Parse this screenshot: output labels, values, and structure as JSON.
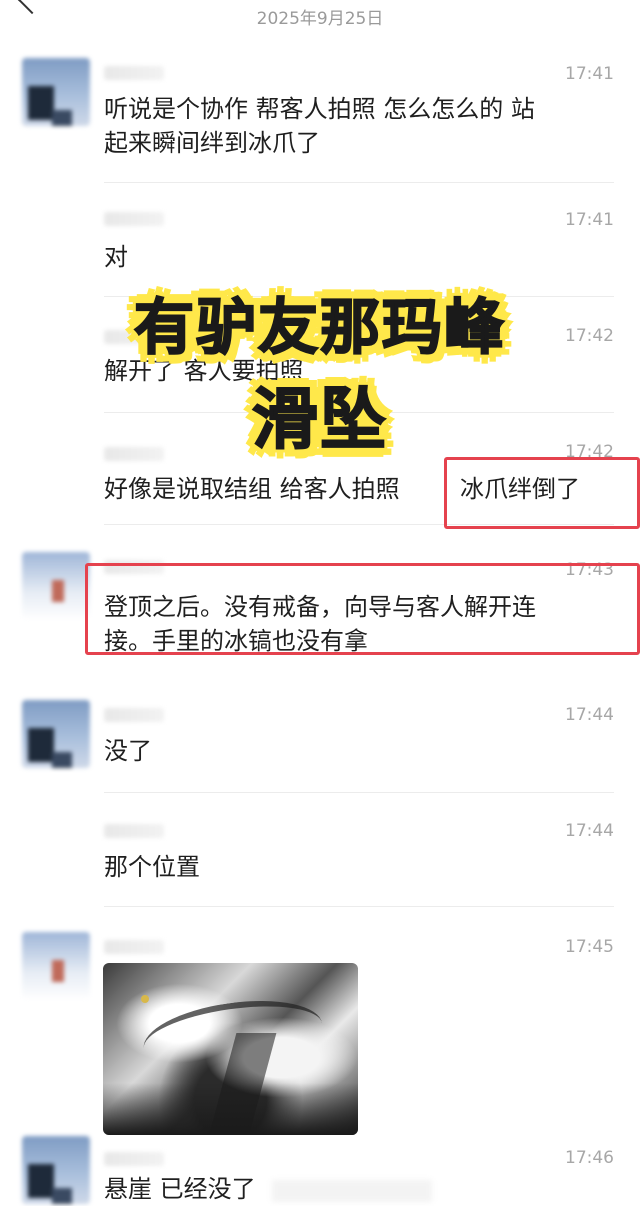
{
  "header": {
    "date": "2025年9月25日"
  },
  "overlay": {
    "line1": "有驴友那玛峰",
    "line2": "滑坠"
  },
  "messages": [
    {
      "time": "17:41",
      "text": "听说是个协作 帮客人拍照 怎么怎么的 站\n起来瞬间绊到冰爪了"
    },
    {
      "time": "17:41",
      "text": "对"
    },
    {
      "time": "17:42",
      "text": "解开了 客人要拍照"
    },
    {
      "time": "17:42",
      "text": "好像是说取结组 给客人拍照",
      "highlight": "冰爪绊倒了"
    },
    {
      "time": "17:43",
      "text": "登顶之后。没有戒备，向导与客人解开连\n接。手里的冰镐也没有拿"
    },
    {
      "time": "17:44",
      "text": "没了"
    },
    {
      "time": "17:44",
      "text": "那个位置"
    },
    {
      "time": "17:45",
      "image": "mountain-photo"
    },
    {
      "time": "17:46",
      "text": "悬崖 已经没了"
    }
  ],
  "colors": {
    "highlight_border": "#e5424e",
    "overlay_fill": "#ffe84a"
  }
}
